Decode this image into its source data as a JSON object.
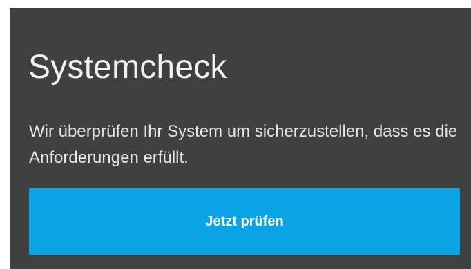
{
  "systemcheck": {
    "title": "Systemcheck",
    "description": "Wir überprüfen Ihr System um sicherzustellen, dass es die Anforderungen erfüllt.",
    "button_label": "Jetzt prüfen"
  },
  "colors": {
    "panel_background": "#3f4141",
    "button_background": "#0aa3e6",
    "text_light": "#f2f2f2"
  }
}
